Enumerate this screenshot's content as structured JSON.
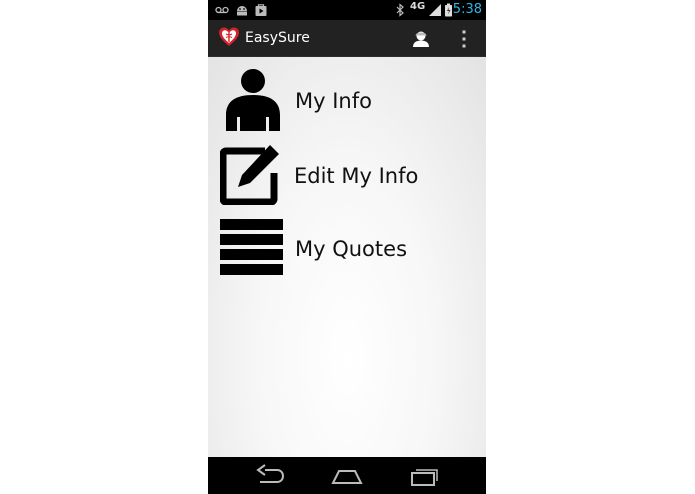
{
  "status_bar": {
    "time": "5:38",
    "network": "4G",
    "left_icons": [
      "voicemail-icon",
      "android-debug-icon",
      "play-store-icon"
    ],
    "right_icons": [
      "bluetooth-icon",
      "network-4g-icon",
      "signal-icon",
      "battery-icon"
    ],
    "time_color": "#33b5e5"
  },
  "action_bar": {
    "title": "EasySure",
    "logo": "heart-caduceus-logo",
    "actions": [
      "account-icon",
      "overflow-menu-icon"
    ],
    "background": "#222222"
  },
  "menu": {
    "items": [
      {
        "label": "My Info",
        "icon": "person-icon"
      },
      {
        "label": "Edit My Info",
        "icon": "edit-square-icon"
      },
      {
        "label": "My Quotes",
        "icon": "list-icon"
      }
    ]
  },
  "nav_bar": {
    "buttons": [
      "back-icon",
      "home-icon",
      "recent-apps-icon"
    ]
  }
}
